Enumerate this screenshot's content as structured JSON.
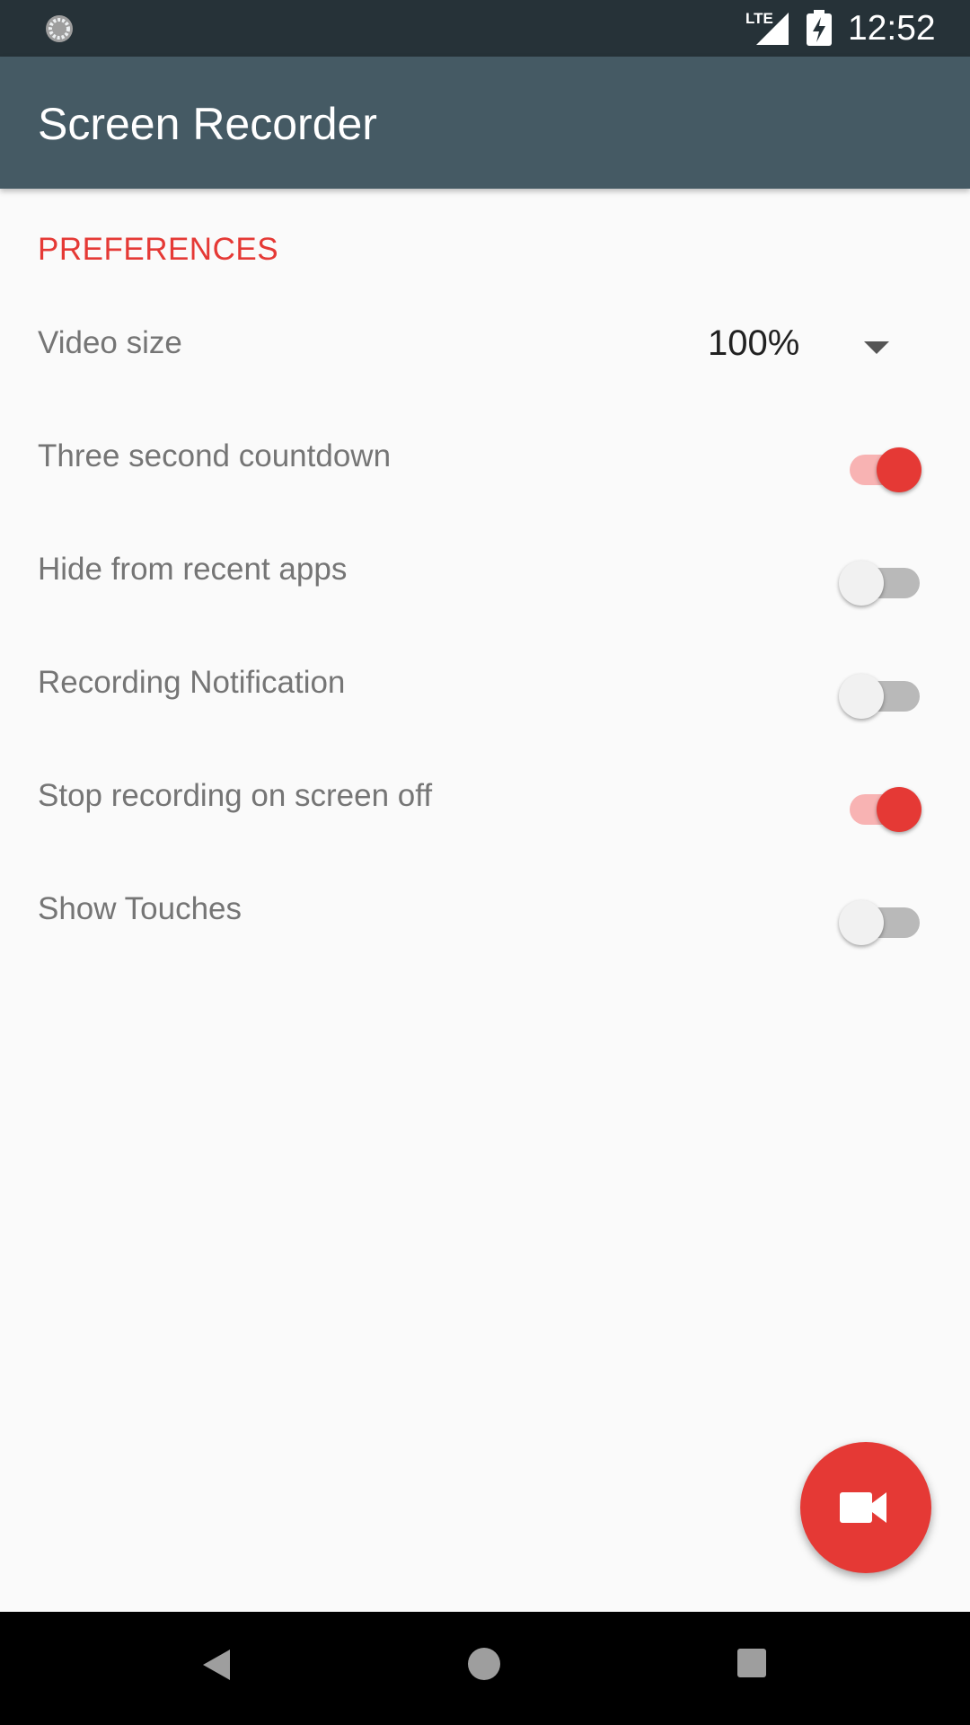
{
  "status_bar": {
    "time": "12:52",
    "network": "LTE",
    "icons": [
      "sync-icon",
      "signal-icon",
      "battery-charging-icon"
    ]
  },
  "app_bar": {
    "title": "Screen Recorder"
  },
  "preferences": {
    "header": "PREFERENCES",
    "video_size": {
      "label": "Video size",
      "value": "100%"
    },
    "items": [
      {
        "label": "Three second countdown",
        "checked": true
      },
      {
        "label": "Hide from recent apps",
        "checked": false
      },
      {
        "label": "Recording Notification",
        "checked": false
      },
      {
        "label": "Stop recording on screen off",
        "checked": true
      },
      {
        "label": "Show Touches",
        "checked": false
      }
    ]
  },
  "fab": {
    "icon": "videocam-icon"
  },
  "nav_bar": {
    "icons": [
      "back-icon",
      "home-icon",
      "recents-icon"
    ]
  },
  "colors": {
    "accent": "#e53935",
    "app_bar": "#455a64",
    "status_bar": "#263238"
  }
}
